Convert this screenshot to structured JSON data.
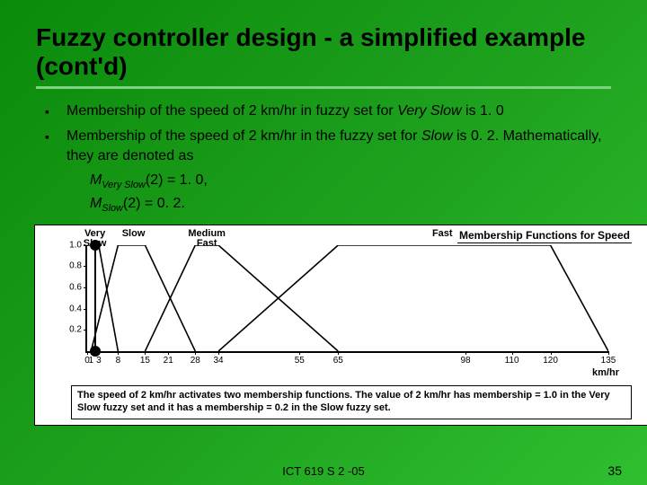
{
  "title": "Fuzzy controller design - a simplified example (cont'd)",
  "bullets": [
    {
      "pre": "Membership of the speed of 2 km/hr in fuzzy set for ",
      "term": "Very Slow",
      "post": " is 1. 0"
    },
    {
      "pre": "Membership of the speed of 2 km/hr in the fuzzy set for ",
      "term": "Slow",
      "post": " is 0. 2. Mathematically, they are denoted as"
    }
  ],
  "equations": [
    {
      "m": "M",
      "sub": "Very Slow",
      "arg": "(2) = 1. 0,"
    },
    {
      "m": "M",
      "sub": "Slow",
      "arg": "(2) = 0. 2."
    }
  ],
  "chart_data": {
    "type": "line",
    "title": "Membership Functions for Speed",
    "xlabel": "km/hr",
    "ylabel": "",
    "xlim": [
      0,
      135
    ],
    "ylim": [
      0,
      1.0
    ],
    "y_ticks": [
      0.2,
      0.4,
      0.6,
      0.8,
      1.0
    ],
    "x_ticks": [
      0,
      1,
      3,
      8,
      15,
      21,
      28,
      34,
      55,
      65,
      98,
      110,
      120,
      135
    ],
    "series": [
      {
        "name": "Very Slow",
        "points": [
          [
            0,
            1.0
          ],
          [
            3,
            1.0
          ],
          [
            8,
            0.0
          ]
        ]
      },
      {
        "name": "Slow",
        "points": [
          [
            1,
            0.0
          ],
          [
            8,
            1.0
          ],
          [
            15,
            1.0
          ],
          [
            28,
            0.0
          ]
        ]
      },
      {
        "name": "Medium Fast",
        "points": [
          [
            15,
            0.0
          ],
          [
            28,
            1.0
          ],
          [
            34,
            1.0
          ],
          [
            65,
            0.0
          ]
        ]
      },
      {
        "name": "Fast",
        "points": [
          [
            34,
            0.0
          ],
          [
            65,
            1.0
          ],
          [
            120,
            1.0
          ],
          [
            135,
            0.0
          ]
        ]
      }
    ],
    "marker_x": 2,
    "category_label_x": {
      "Very Slow": 2,
      "Slow": 12,
      "Medium Fast": 31,
      "Fast": 92
    },
    "caption": "The speed of 2 km/hr activates two membership functions. The value of 2 km/hr has membership = 1.0 in the Very Slow fuzzy set and it has a membership = 0.2 in the Slow fuzzy set."
  },
  "footer": "ICT 619 S 2 -05",
  "page_number": "35"
}
